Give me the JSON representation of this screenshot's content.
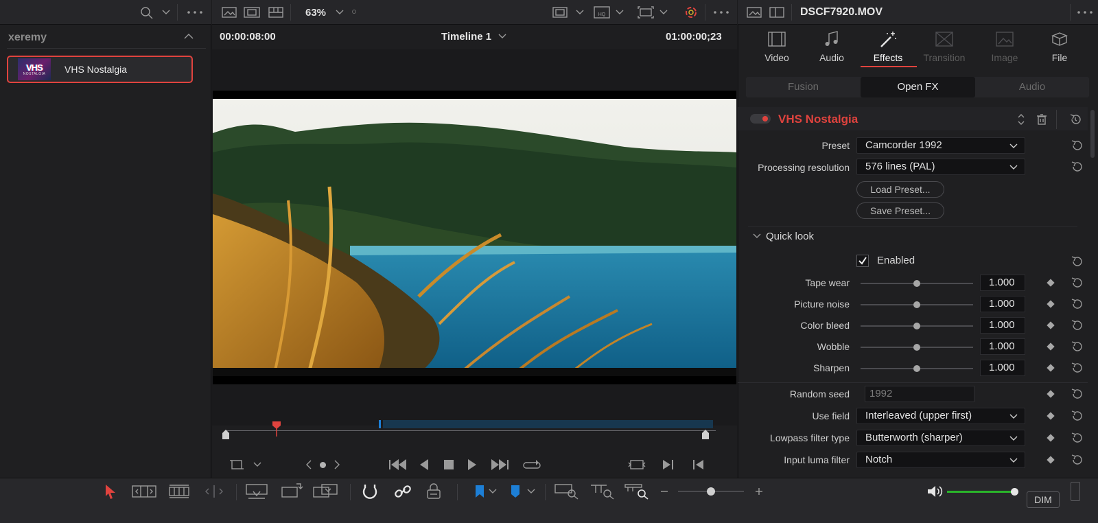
{
  "viewer": {
    "zoom": "63%",
    "timecode_source": "00:00:08:00",
    "timeline_name": "Timeline 1",
    "timecode_record": "01:00:00;23"
  },
  "media_pool": {
    "bin_name": "xeremy",
    "clip": {
      "name": "VHS Nostalgia",
      "thumb_text": "VHS",
      "thumb_sub": "NOSTALGIA"
    }
  },
  "inspector": {
    "filename": "DSCF7920.MOV",
    "tabs": [
      {
        "label": "Video",
        "icon": "film-icon",
        "state": "normal"
      },
      {
        "label": "Audio",
        "icon": "music-note-icon",
        "state": "normal"
      },
      {
        "label": "Effects",
        "icon": "magic-wand-icon",
        "state": "active"
      },
      {
        "label": "Transition",
        "icon": "transition-icon",
        "state": "disabled"
      },
      {
        "label": "Image",
        "icon": "image-icon",
        "state": "disabled"
      },
      {
        "label": "File",
        "icon": "file-icon",
        "state": "normal"
      }
    ],
    "subtabs": [
      {
        "label": "Fusion",
        "active": false
      },
      {
        "label": "Open FX",
        "active": true
      },
      {
        "label": "Audio",
        "active": false
      }
    ],
    "effect": {
      "name": "VHS Nostalgia",
      "preset": {
        "label": "Preset",
        "value": "Camcorder 1992"
      },
      "processing_resolution": {
        "label": "Processing resolution",
        "value": "576 lines (PAL)"
      },
      "load_preset": "Load Preset...",
      "save_preset": "Save Preset...",
      "quick_look": {
        "section_label": "Quick look",
        "enabled_label": "Enabled",
        "enabled": true,
        "sliders": [
          {
            "label": "Tape wear",
            "value": "1.000",
            "fraction": 0.5
          },
          {
            "label": "Picture noise",
            "value": "1.000",
            "fraction": 0.5
          },
          {
            "label": "Color bleed",
            "value": "1.000",
            "fraction": 0.5
          },
          {
            "label": "Wobble",
            "value": "1.000",
            "fraction": 0.5
          },
          {
            "label": "Sharpen",
            "value": "1.000",
            "fraction": 0.5
          }
        ]
      },
      "random_seed": {
        "label": "Random seed",
        "value": "1992"
      },
      "use_field": {
        "label": "Use field",
        "value": "Interleaved (upper first)"
      },
      "lowpass": {
        "label": "Lowpass filter type",
        "value": "Butterworth (sharper)"
      },
      "input_luma": {
        "label": "Input luma filter",
        "value": "Notch"
      }
    }
  },
  "bottom": {
    "dim_label": "DIM",
    "volume_fraction": 1.0,
    "zoom_slider_fraction": 0.5
  },
  "colors": {
    "accent_red": "#e0433e",
    "timeline_blue": "#1d7fd6",
    "volume_green": "#2ab52a"
  }
}
